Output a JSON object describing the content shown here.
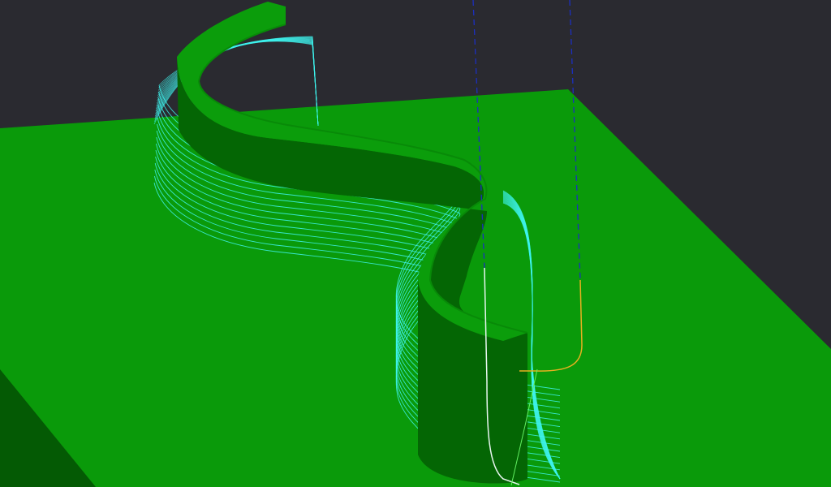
{
  "viewport": {
    "label": "",
    "colors": {
      "background": "#2a2a30",
      "stock_top": "#0a9a0a",
      "stock_side": "#045a04",
      "wall_top": "#0b9d0b",
      "wall_side": "#046604",
      "toolpath_offset": "#3ff3ee",
      "toolpath_lead": "#e8f6f0",
      "toolpath_link": "#e8b020",
      "rapid_move": "#1c2fbf"
    },
    "toolpath": {
      "pass_count": 16,
      "style": "offset contour passes around S-shaped wall"
    }
  }
}
